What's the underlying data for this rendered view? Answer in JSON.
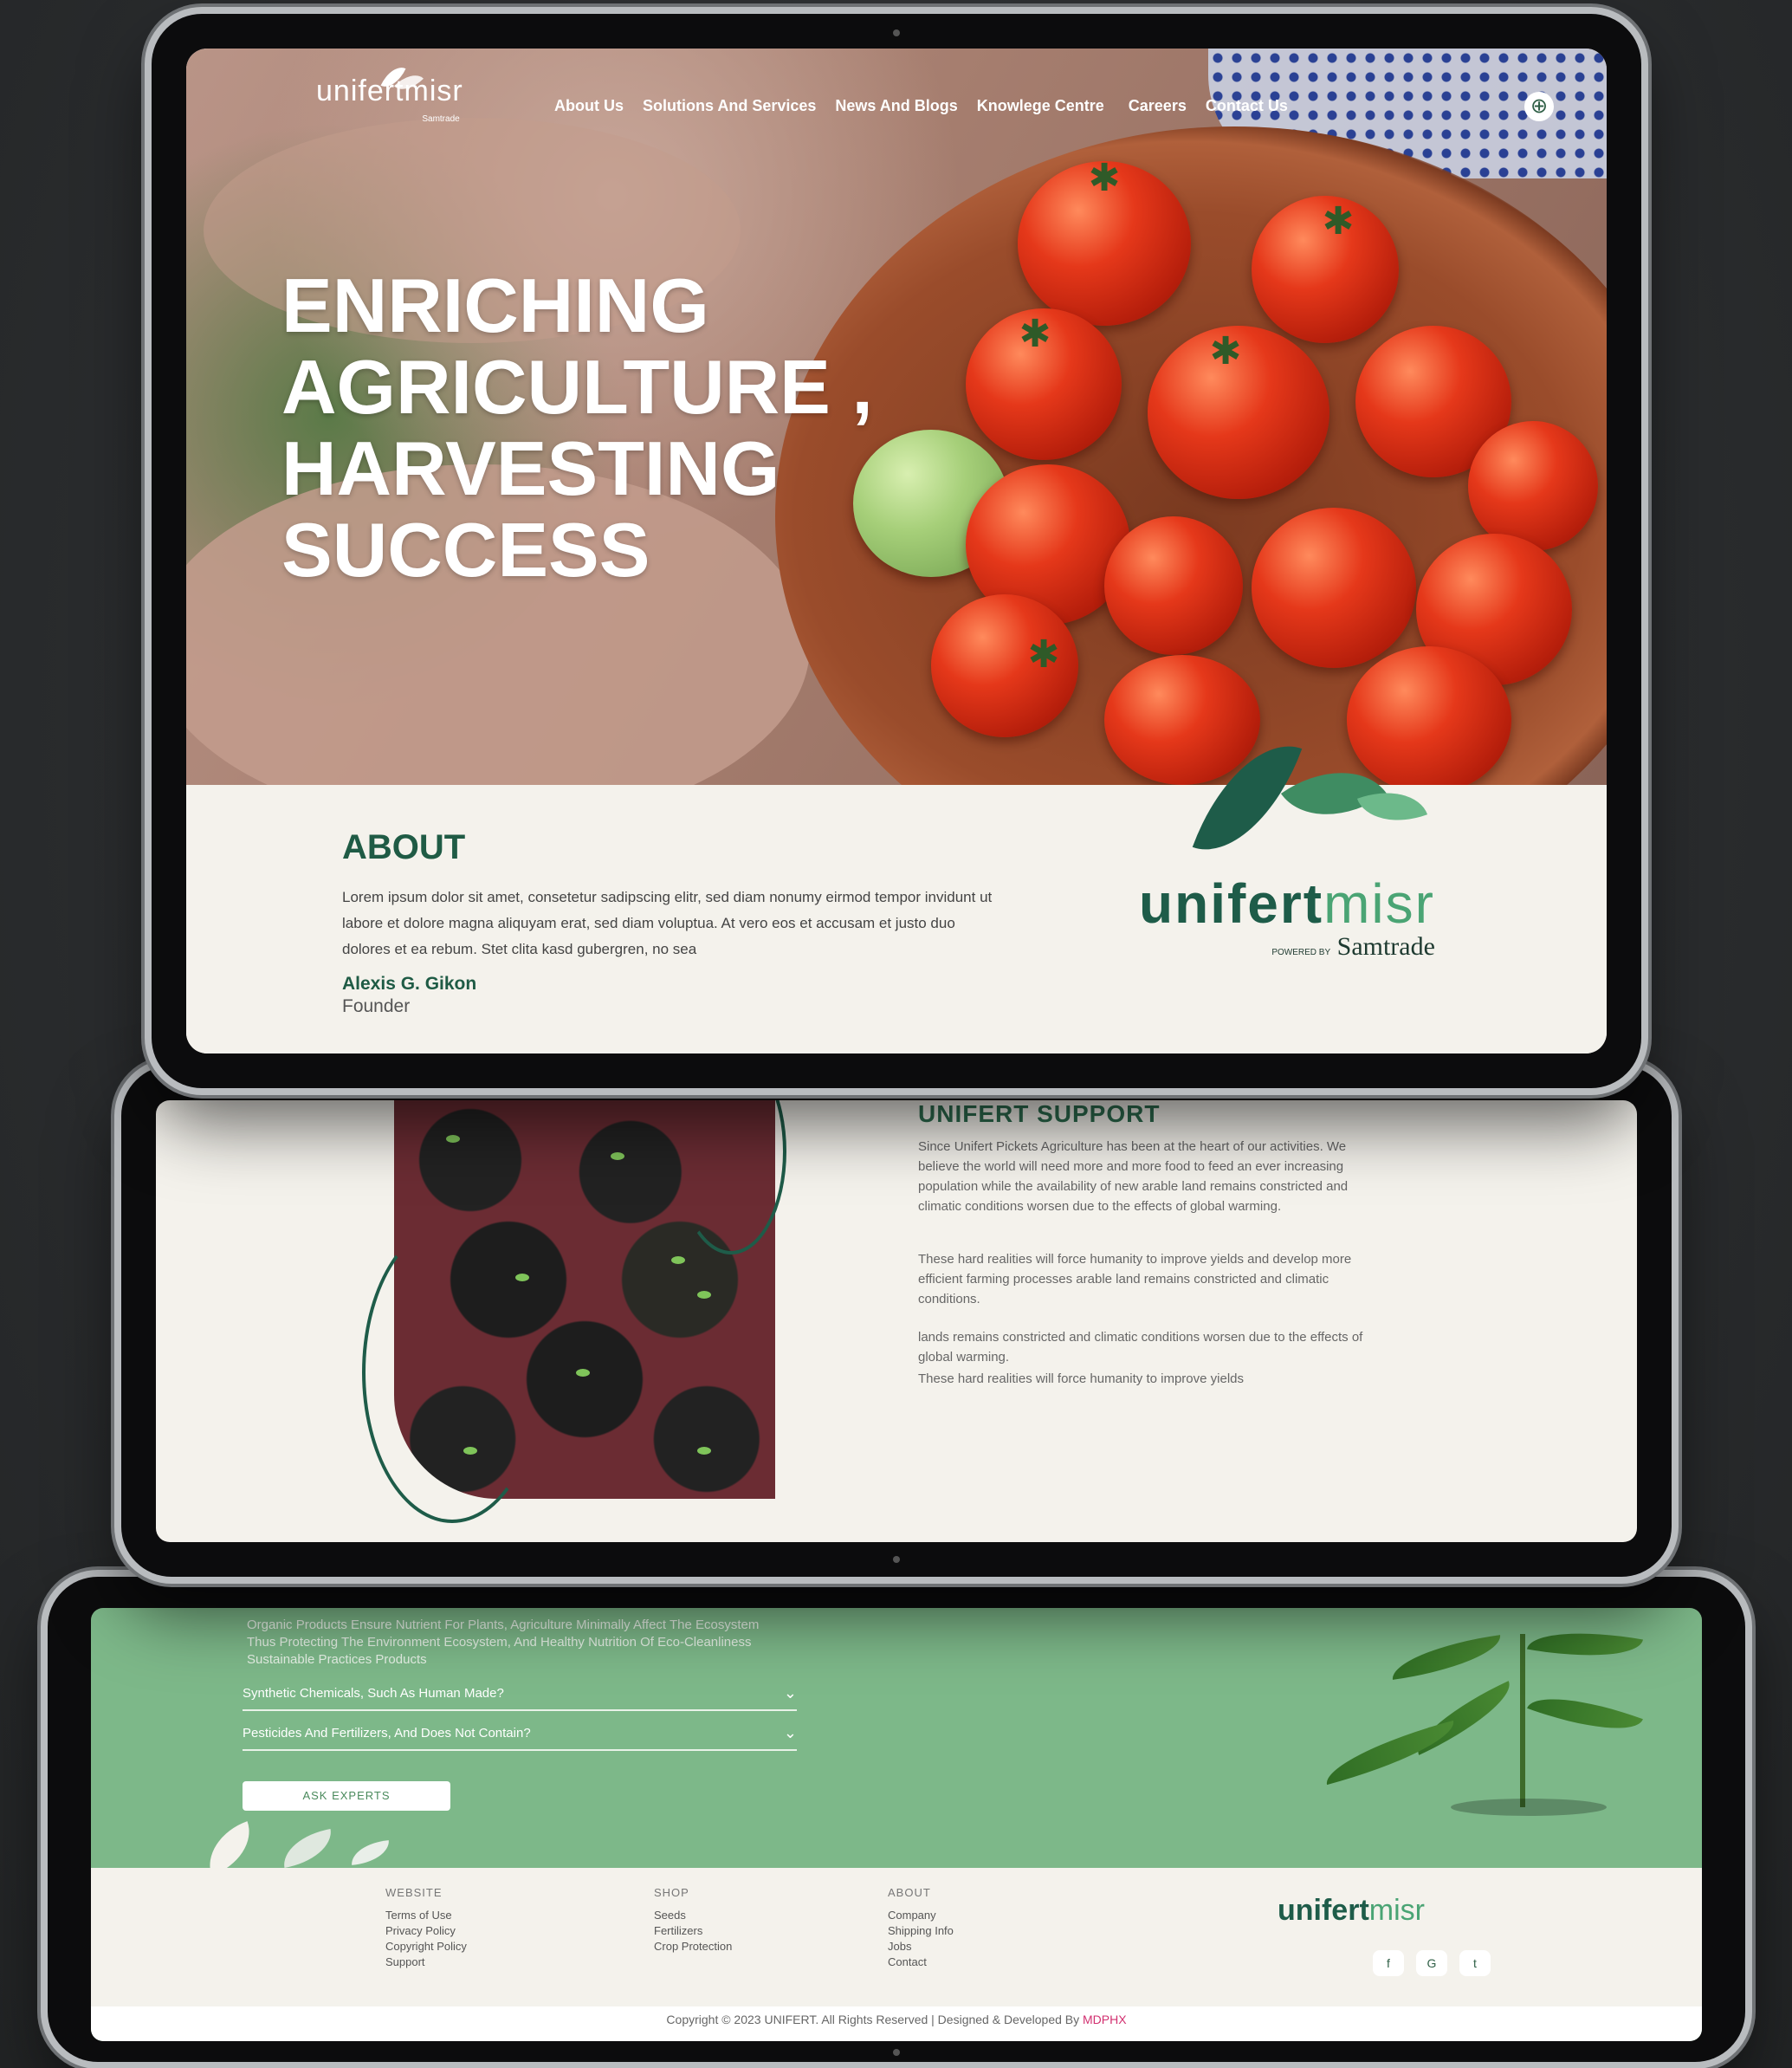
{
  "brand": {
    "name_a": "unifert",
    "name_b": "misr",
    "powered_by": "POWERED BY",
    "parent": "Samtrade",
    "accent": "#1f5b45",
    "accent_light": "#4aa474"
  },
  "nav": {
    "items": [
      "About Us",
      "Solutions And Services",
      "News And Blogs",
      "Knowlege Centre",
      "Careers",
      "Contact Us"
    ],
    "globe_icon": "globe-icon"
  },
  "hero": {
    "line1": "ENRICHING",
    "line2": "AGRICULTURE ,",
    "line3": "HARVESTING",
    "line4": "SUCCESS"
  },
  "about": {
    "title": "ABOUT",
    "body": "Lorem ipsum dolor sit amet, consetetur sadipscing elitr, sed diam nonumy eirmod tempor invidunt ut labore et dolore magna aliquyam erat, sed diam voluptua. At vero eos et accusam et justo duo dolores et ea rebum. Stet clita kasd gubergren, no sea",
    "name": "Alexis G. Gikon",
    "role": "Founder"
  },
  "support": {
    "title": "UNIFERT SUPPORT",
    "p1": "Since Unifert Pickets Agriculture has been at the heart of our activities. We believe the world will need more and more food to feed an ever increasing population while the availability of new arable land remains constricted and climatic conditions worsen due to the effects of global warming.",
    "p2": "These hard realities will force humanity to improve yields and develop more efficient farming processes arable land remains constricted and climatic conditions.",
    "p3": "lands remains constricted and climatic conditions worsen due to the effects of global warming.",
    "p4": "These hard realities will force humanity to improve yields"
  },
  "faq": {
    "intro": "Organic Products Ensure Nutrient For Plants, Agriculture Minimally Affect The Ecosystem Thus Protecting The Environment Ecosystem, And Healthy Nutrition Of Eco-Cleanliness Sustainable Practices Products",
    "q1": "Synthetic Chemicals, Such As Human Made?",
    "q2": "Pesticides And Fertilizers, And Does Not Contain?",
    "button": "ASK EXPERTS"
  },
  "footer": {
    "website_title": "WEBSITE",
    "website_links": [
      "Terms of Use",
      "Privacy Policy",
      "Copyright Policy",
      "Support"
    ],
    "shop_title": "SHOP",
    "shop_links": [
      "Seeds",
      "Fertilizers",
      "Crop Protection"
    ],
    "about_title": "ABOUT",
    "about_links": [
      "Company",
      "Shipping Info",
      "Jobs",
      "Contact"
    ],
    "social": [
      "facebook-icon",
      "google-icon",
      "twitter-icon"
    ],
    "copyright": "Copyright © 2023 UNIFERT. All Rights Reserved | Designed & Developed By",
    "developer": "MDPHX"
  }
}
